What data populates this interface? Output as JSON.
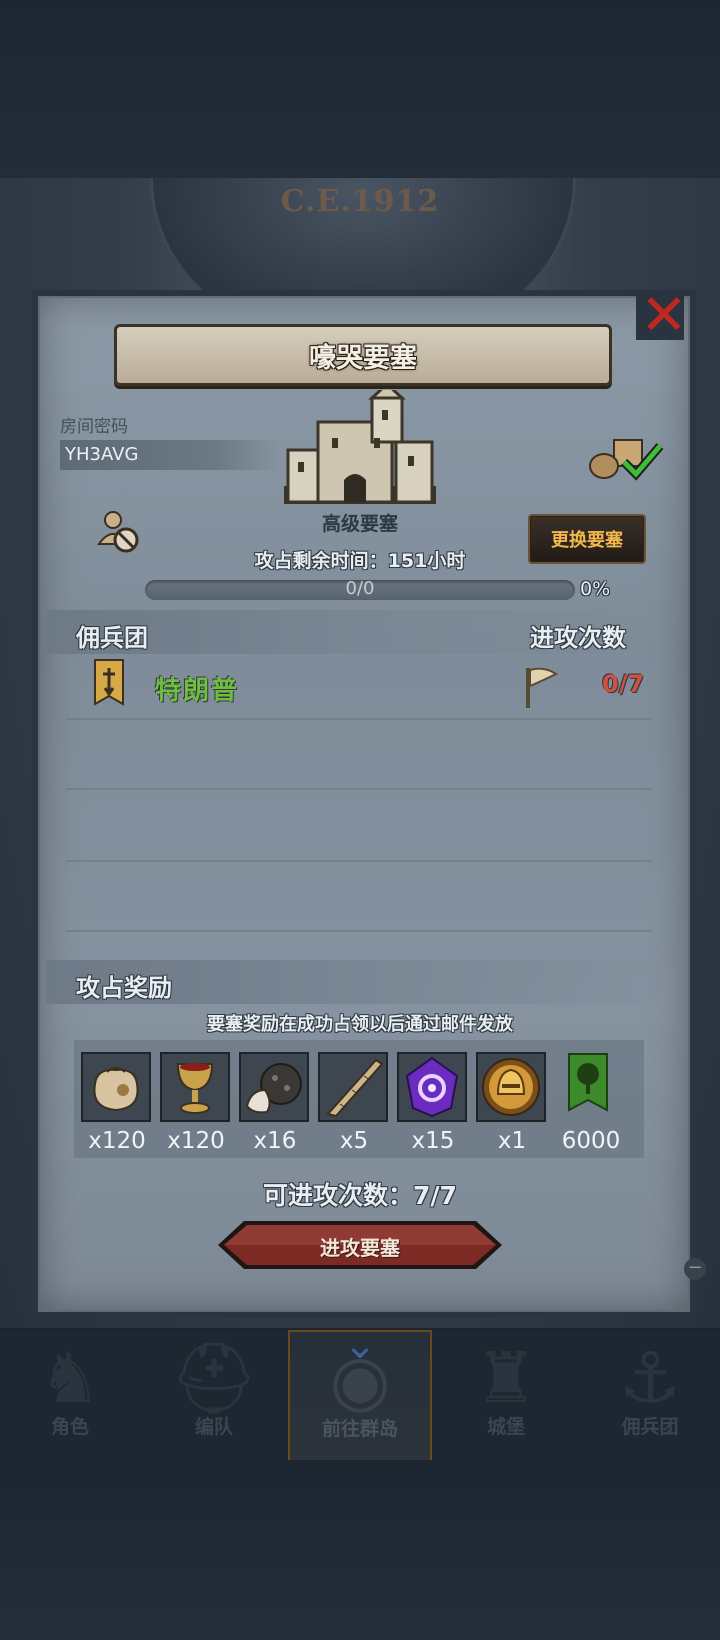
{
  "header": {
    "era_label": "C.E.1912"
  },
  "dialog": {
    "title": "嚎哭要塞",
    "room_code_label": "房间密码",
    "room_code_value": "YH3AVG",
    "fortress_type": "高级要塞",
    "change_button": "更换要塞",
    "timer_text": "攻占剩余时间：151小时",
    "progress": {
      "count_text": "0/0",
      "percent_text": "0%",
      "fraction": 0
    },
    "mercenary_header": "佣兵团",
    "attacks_header": "进攻次数",
    "mercenaries": [
      {
        "name": "特朗普",
        "attacks": "0/7",
        "icon": "banner-icon"
      }
    ],
    "reward_header": "攻占奖励",
    "reward_note": "要塞奖励在成功占领以后通过邮件发放",
    "rewards": [
      {
        "icon": "sack-icon",
        "qty": "x120"
      },
      {
        "icon": "goblet-icon",
        "qty": "x120"
      },
      {
        "icon": "ore-icon",
        "qty": "x16"
      },
      {
        "icon": "horn-icon",
        "qty": "x5"
      },
      {
        "icon": "purple-crystal-icon",
        "qty": "x15"
      },
      {
        "icon": "gold-helmet-icon",
        "qty": "x1"
      },
      {
        "icon": "tree-banner-icon",
        "qty": "6000"
      }
    ],
    "available_attacks": "可进攻次数：7/7",
    "attack_button": "进攻要塞"
  },
  "bottom_nav": [
    {
      "label": "角色",
      "icon": "knight-icon"
    },
    {
      "label": "编队",
      "icon": "helmet-icon"
    },
    {
      "label": "前往群岛",
      "icon": "globe-icon",
      "active": true
    },
    {
      "label": "城堡",
      "icon": "castle-icon"
    },
    {
      "label": "佣兵团",
      "icon": "ship-icon"
    }
  ],
  "colors": {
    "accent_gold": "#f0b74d",
    "merc_name": "#6fbf3d",
    "attacks_red": "#d05042",
    "close_red": "#c0281e"
  }
}
